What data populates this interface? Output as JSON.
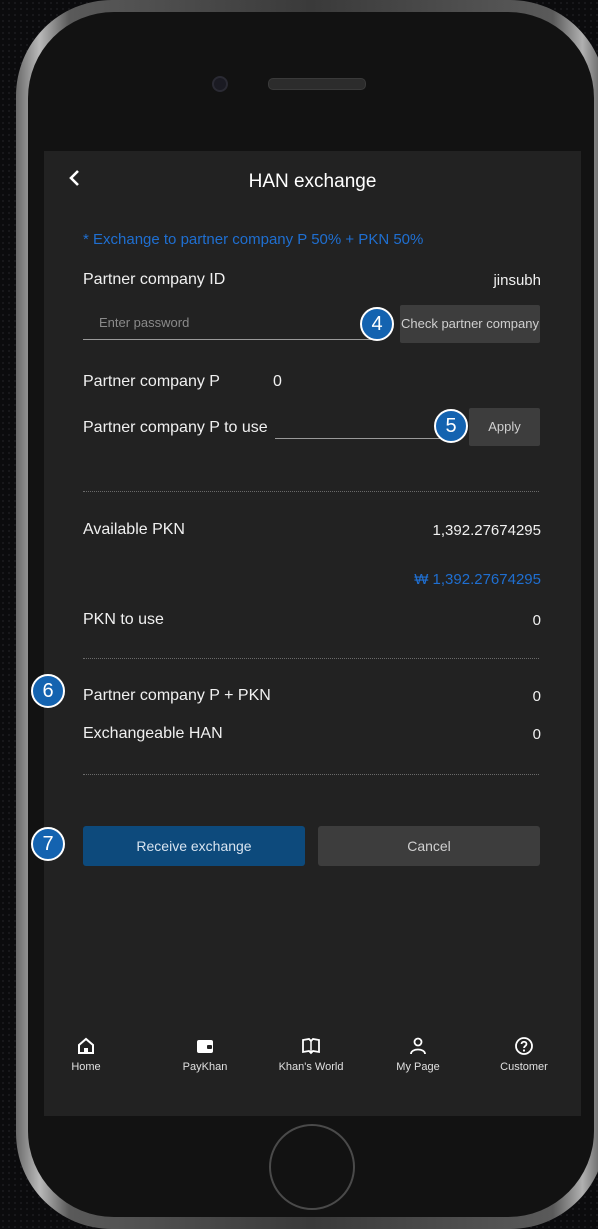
{
  "header": {
    "title": "HAN exchange",
    "back_icon": "chevron-left-icon"
  },
  "notice": "* Exchange to partner company P 50% + PKN 50%",
  "partner_id": {
    "label": "Partner company ID",
    "value": "jinsubh"
  },
  "password": {
    "placeholder": "Enter password",
    "value": "",
    "check_button": "Check partner company"
  },
  "partner_p": {
    "label": "Partner company P",
    "value": "0"
  },
  "partner_p_use": {
    "label": "Partner company P to use",
    "value": "",
    "apply_button": "Apply"
  },
  "available_pkn": {
    "label": "Available PKN",
    "value": "1,392.27674295",
    "krw": "₩ 1,392.27674295"
  },
  "pkn_to_use": {
    "label": "PKN to use",
    "value": "0"
  },
  "sum": {
    "label": "Partner company P + PKN",
    "value": "0"
  },
  "exchangeable": {
    "label": "Exchangeable HAN",
    "value": "0"
  },
  "actions": {
    "receive": "Receive exchange",
    "cancel": "Cancel"
  },
  "badges": [
    "4",
    "5",
    "6",
    "7"
  ],
  "nav": [
    {
      "label": "Home",
      "icon": "home-icon"
    },
    {
      "label": "PayKhan",
      "icon": "wallet-icon"
    },
    {
      "label": "Khan's World",
      "icon": "book-icon"
    },
    {
      "label": "My Page",
      "icon": "person-icon"
    },
    {
      "label": "Customer",
      "icon": "help-icon"
    }
  ],
  "colors": {
    "accent": "#1f6fd1",
    "primary_button": "#0d4a7c",
    "badge": "#1463b0",
    "screen_bg": "#222222"
  }
}
